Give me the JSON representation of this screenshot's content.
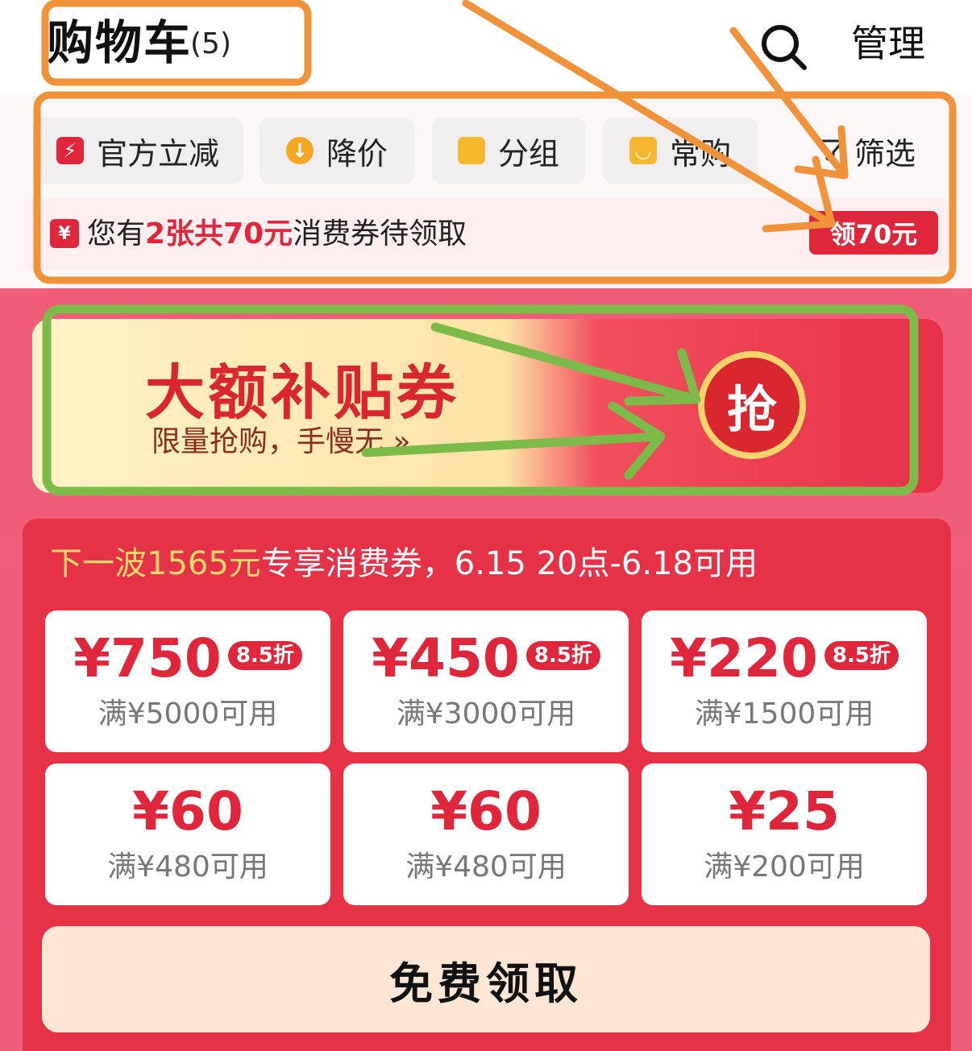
{
  "header": {
    "title": "购物车",
    "count": "(5)",
    "manage_label": "管理",
    "search_icon": "search-icon"
  },
  "chips": [
    {
      "label": "官方立减",
      "icon": "lightning-icon",
      "color": "#e0263a"
    },
    {
      "label": "降价",
      "icon": "arrow-down-icon",
      "color": "#f5a623"
    },
    {
      "label": "分组",
      "icon": "folder-icon",
      "color": "#f5b82e"
    },
    {
      "label": "常购",
      "icon": "bag-icon",
      "color": "#f5b82e"
    }
  ],
  "filter_label": "筛选",
  "voucher_strip": {
    "prefix": "您有",
    "highlight": "2张共70元",
    "suffix": "消费券待领取",
    "button": "领70元",
    "badge": "¥"
  },
  "banner": {
    "title": "大额补贴券",
    "subtitle": "限量抢购，手慢无 »",
    "grab_label": "抢"
  },
  "panel": {
    "title_highlight": "下一波1565元",
    "title_rest": "专享消费券，6.15 20点-6.18可用",
    "coupons": [
      {
        "amount": "¥750",
        "discount": "8.5折",
        "condition": "满¥5000可用"
      },
      {
        "amount": "¥450",
        "discount": "8.5折",
        "condition": "满¥3000可用"
      },
      {
        "amount": "¥220",
        "discount": "8.5折",
        "condition": "满¥1500可用"
      },
      {
        "amount": "¥60",
        "discount": "",
        "condition": "满¥480可用"
      },
      {
        "amount": "¥60",
        "discount": "",
        "condition": "满¥480可用"
      },
      {
        "amount": "¥25",
        "discount": "",
        "condition": "满¥200可用"
      }
    ],
    "claim_button": "免费领取"
  },
  "colors": {
    "accent_red": "#e0263a",
    "annotation_orange": "#f0923a",
    "annotation_green": "#7cba4a"
  }
}
